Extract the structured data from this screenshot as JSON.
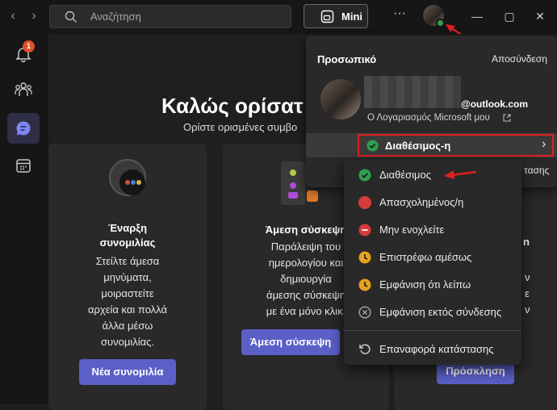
{
  "titlebar": {
    "search_placeholder": "Αναζήτηση",
    "mini_label": "Mini",
    "more_symbol": "···"
  },
  "rail": {
    "activity_badge": "1"
  },
  "welcome": {
    "title": "Καλώς ορίσατ",
    "subtitle": "Ορίστε ορισμένες συμβο"
  },
  "cards": [
    {
      "title_lines": [
        "Έναρξη",
        "συνομιλίας"
      ],
      "body_lines": [
        "Στείλτε άμεσα",
        "μηνύματα,",
        "μοιραστείτε",
        "αρχεία και πολλά",
        "άλλα μέσω",
        "συνομιλίας."
      ],
      "button": "Νέα συνομιλία"
    },
    {
      "title": "Άμεση σύσκεψη",
      "body_lines": [
        "Παράλειψη του",
        "ημερολογίου και",
        "δημιουργία",
        "άμεσης σύσκεψη",
        "με ένα μόνο κλικ."
      ],
      "button": "Άμεση σύσκεψη"
    },
    {
      "title_fragment": "n",
      "body_fragments": [
        "ν",
        "ε",
        "ν"
      ],
      "button": "Πρόσκληση",
      "partial_line": "τασης"
    }
  ],
  "account": {
    "heading": "Προσωπικό",
    "sign_out": "Αποσύνδεση",
    "email": "@outlook.com",
    "ms_account_link": "Ο Λογαριασμός Microsoft μου",
    "current_status": "Διαθέσιμος-η"
  },
  "status_menu": [
    {
      "label": "Διαθέσιμος",
      "color": "#2fa04f",
      "icon": "available-icon"
    },
    {
      "label": "Απασχολημένος/η",
      "color": "#d83b3b",
      "icon": "busy-icon"
    },
    {
      "label": "Μην ενοχλείτε",
      "color": "#d83b3b",
      "icon": "do-not-disturb-icon"
    },
    {
      "label": "Επιστρέφω αμέσως",
      "color": "#e8a21d",
      "icon": "be-right-back-icon"
    },
    {
      "label": "Εμφάνιση ότι λείπω",
      "color": "#e8a21d",
      "icon": "away-icon"
    },
    {
      "label": "Εμφάνιση εκτός σύνδεσης",
      "color": "#a0a0a0",
      "icon": "offline-icon"
    }
  ],
  "reset_status": "Επαναφορά κατάστασης",
  "colors": {
    "accent": "#5b5fc7",
    "available": "#2fa04f",
    "highlight_red": "#e21f1f"
  }
}
